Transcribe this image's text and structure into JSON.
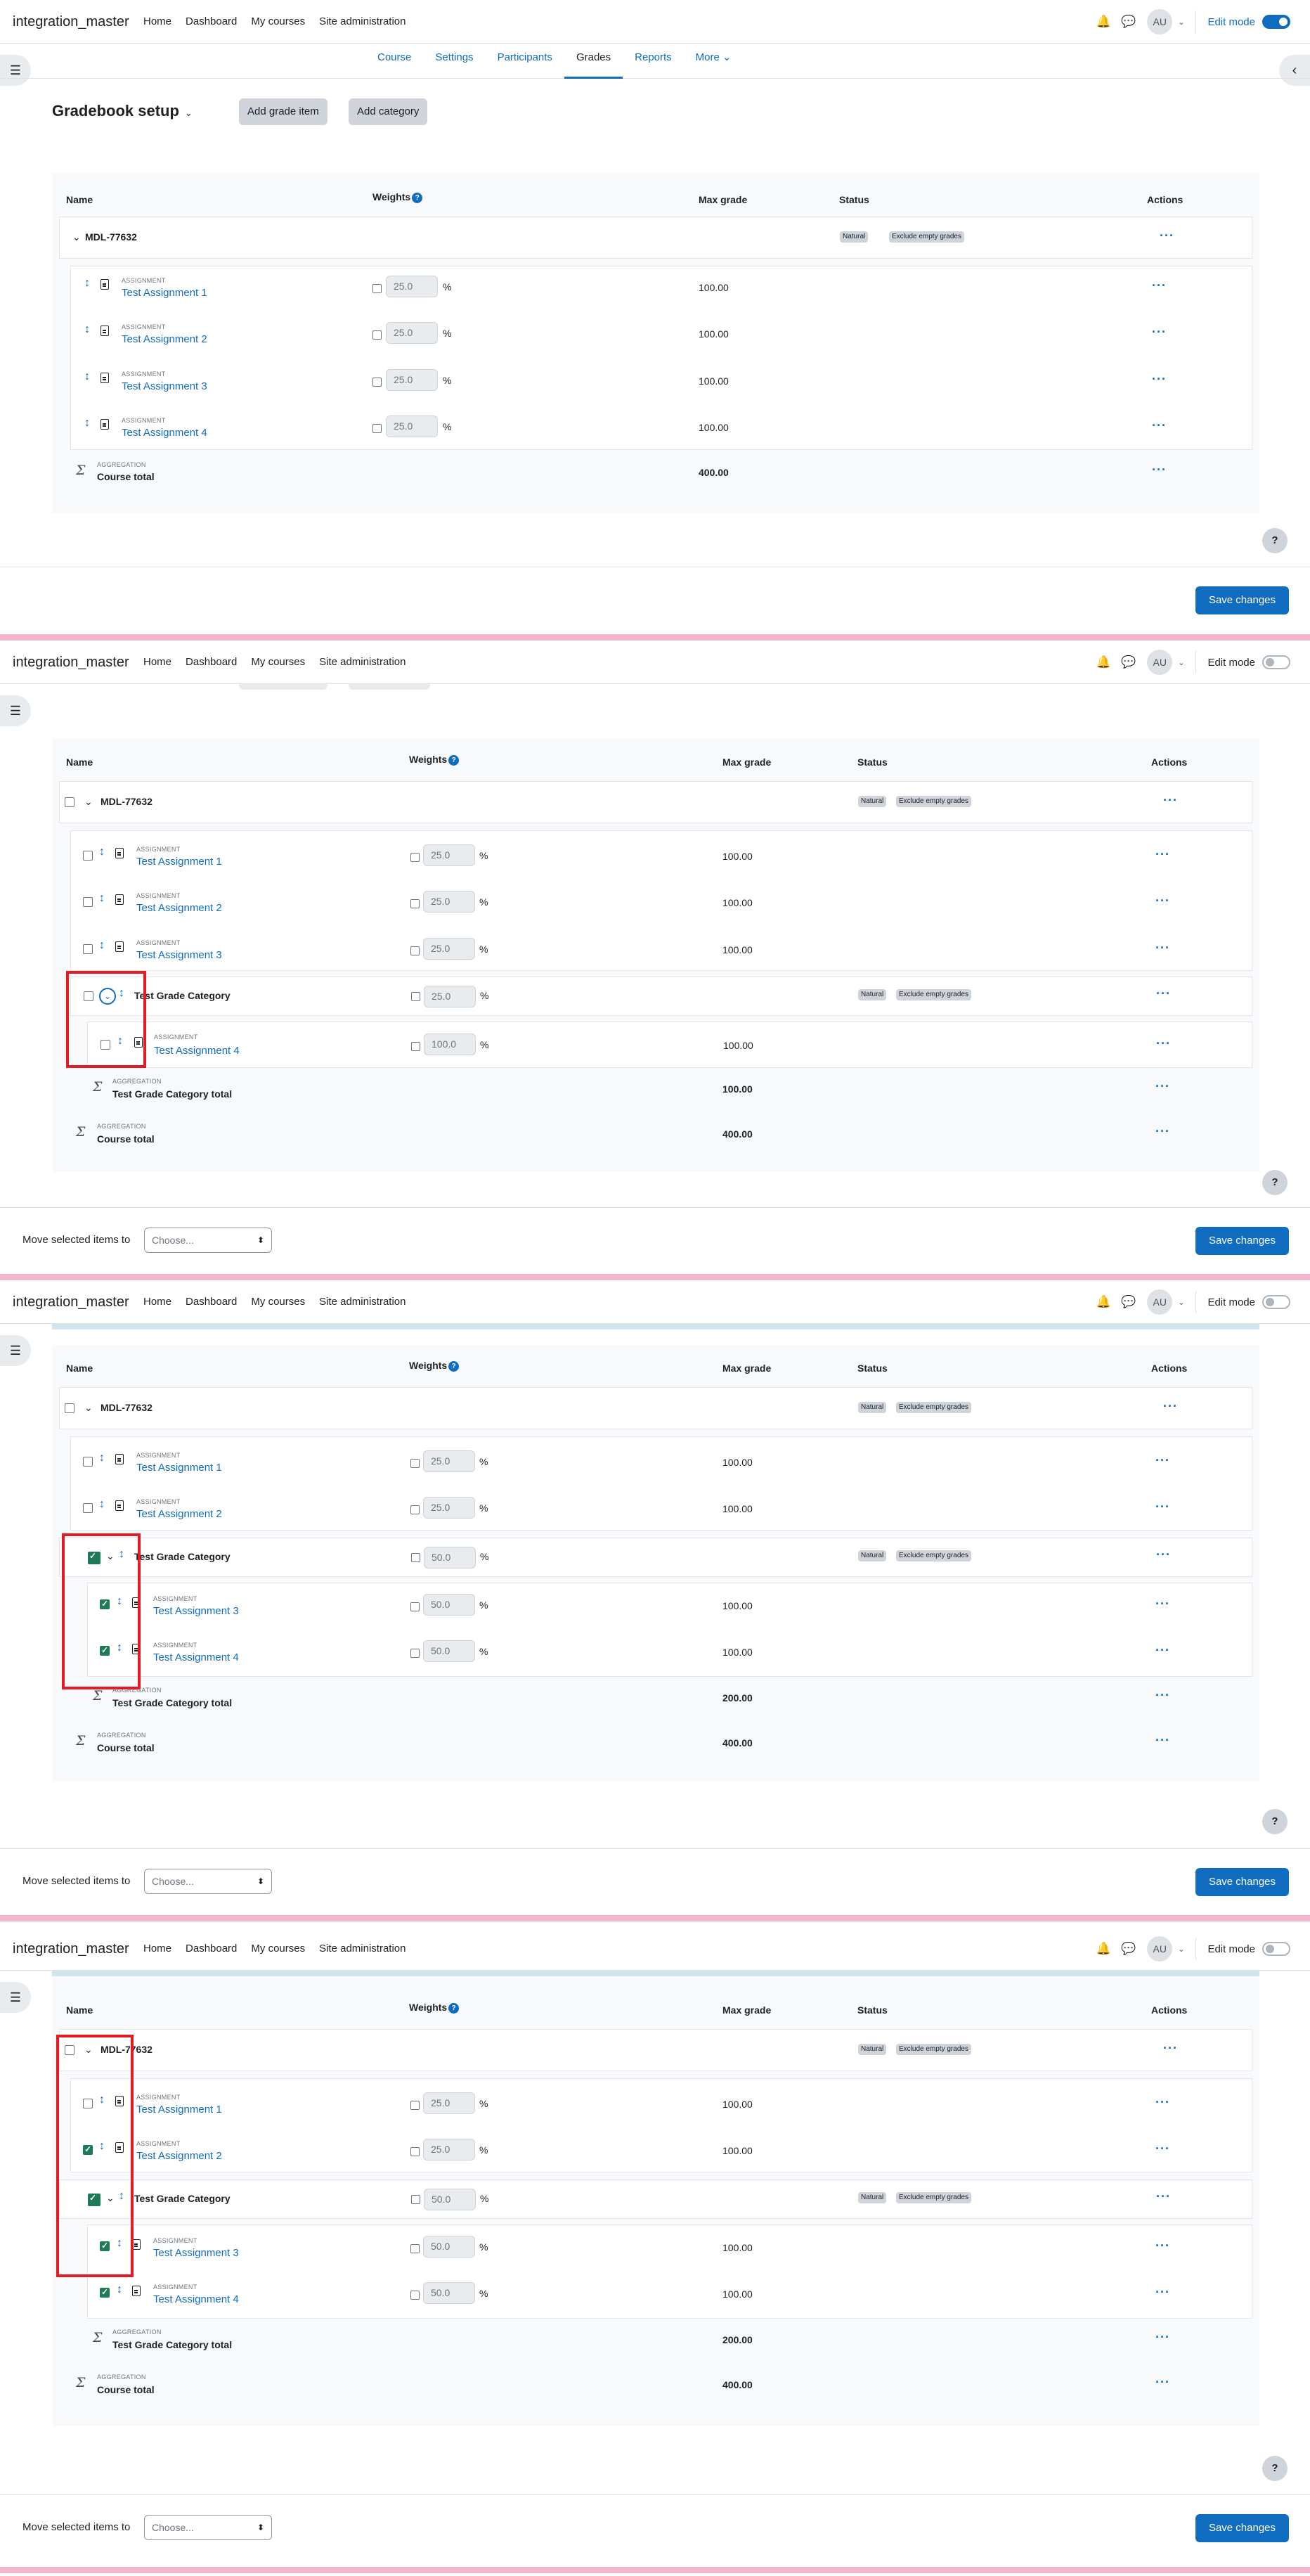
{
  "site_name": "integration_master",
  "nav_links": [
    "Home",
    "Dashboard",
    "My courses",
    "Site administration"
  ],
  "avatar": "AU",
  "edit_mode_label": "Edit mode",
  "tabs": [
    "Course",
    "Settings",
    "Participants",
    "Grades",
    "Reports",
    "More"
  ],
  "active_tab": "Grades",
  "page_title": "Gradebook setup",
  "buttons": {
    "add_grade_item": "Add grade item",
    "add_category": "Add category",
    "save": "Save changes",
    "help": "?"
  },
  "table_headers": {
    "name": "Name",
    "weights": "Weights",
    "max_grade": "Max grade",
    "status": "Status",
    "actions": "Actions"
  },
  "course_name": "MDL-77632",
  "badges": {
    "natural": "Natural",
    "exclude": "Exclude empty grades"
  },
  "item_type": "ASSIGNMENT",
  "agg_type": "AGGREGATION",
  "assignments": [
    "Test Assignment 1",
    "Test Assignment 2",
    "Test Assignment 3",
    "Test Assignment 4"
  ],
  "category_name": "Test Grade Category",
  "category_total": "Test Grade Category total",
  "course_total": "Course total",
  "pct": "%",
  "actions_glyph": "···",
  "move_label": "Move selected items to",
  "select_placeholder": "Choose...",
  "panel1": {
    "weights": [
      "25.0",
      "25.0",
      "25.0",
      "25.0"
    ],
    "grades": [
      "100.00",
      "100.00",
      "100.00",
      "100.00"
    ],
    "course_total": "400.00"
  },
  "panel2": {
    "weights": [
      "25.0",
      "25.0",
      "25.0",
      "25.0",
      "100.0"
    ],
    "grades": [
      "100.00",
      "100.00",
      "100.00",
      "100.00"
    ],
    "cat_total": "100.00",
    "course_total": "400.00"
  },
  "panel3": {
    "weights": [
      "25.0",
      "25.0",
      "50.0",
      "50.0",
      "50.0"
    ],
    "grades": [
      "100.00",
      "100.00",
      "100.00",
      "100.00"
    ],
    "cat_total": "200.00",
    "course_total": "400.00"
  },
  "panel4": {
    "weights": [
      "25.0",
      "25.0",
      "50.0",
      "50.0",
      "50.0"
    ],
    "grades": [
      "100.00",
      "100.00",
      "100.00",
      "100.00"
    ],
    "cat_total": "200.00",
    "course_total": "400.00"
  }
}
